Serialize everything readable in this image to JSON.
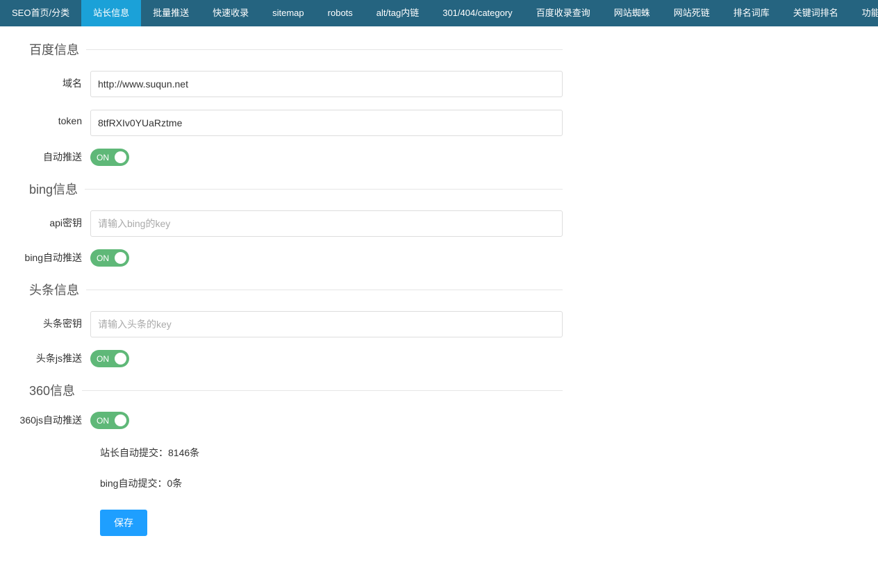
{
  "nav": {
    "items": [
      {
        "label": "SEO首页/分类",
        "active": false
      },
      {
        "label": "站长信息",
        "active": true
      },
      {
        "label": "批量推送",
        "active": false
      },
      {
        "label": "快速收录",
        "active": false
      },
      {
        "label": "sitemap",
        "active": false
      },
      {
        "label": "robots",
        "active": false
      },
      {
        "label": "alt/tag内链",
        "active": false
      },
      {
        "label": "301/404/category",
        "active": false
      },
      {
        "label": "百度收录查询",
        "active": false
      },
      {
        "label": "网站蜘蛛",
        "active": false
      },
      {
        "label": "网站死链",
        "active": false
      },
      {
        "label": "排名词库",
        "active": false
      },
      {
        "label": "关键词排名",
        "active": false
      },
      {
        "label": "功能授权",
        "active": false
      }
    ]
  },
  "sections": {
    "baidu": {
      "legend": "百度信息",
      "domain": {
        "label": "域名",
        "value": "http://www.suqun.net"
      },
      "token": {
        "label": "token",
        "value": "8tfRXIv0YUaRztme"
      },
      "auto_push": {
        "label": "自动推送",
        "state": "ON"
      }
    },
    "bing": {
      "legend": "bing信息",
      "api_key": {
        "label": "api密钥",
        "placeholder": "请输入bing的key",
        "value": ""
      },
      "auto_push": {
        "label": "bing自动推送",
        "state": "ON"
      }
    },
    "toutiao": {
      "legend": "头条信息",
      "key": {
        "label": "头条密钥",
        "placeholder": "请输入头条的key",
        "value": ""
      },
      "js_push": {
        "label": "头条js推送",
        "state": "ON"
      }
    },
    "s360": {
      "legend": "360信息",
      "js_auto_push": {
        "label": "360js自动推送",
        "state": "ON"
      },
      "stats": {
        "zhanzhang": "站长自动提交：8146条",
        "bing": "bing自动提交：0条"
      }
    }
  },
  "buttons": {
    "save": "保存"
  }
}
